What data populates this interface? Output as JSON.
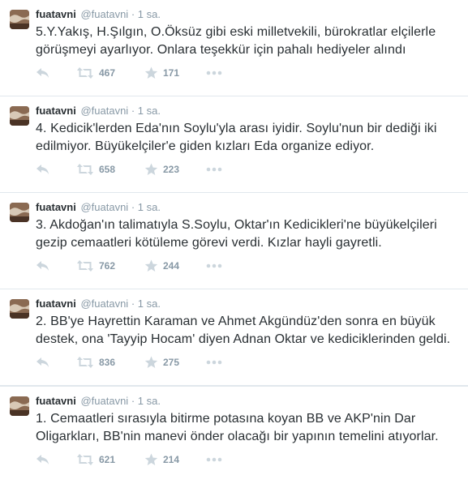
{
  "tweets": [
    {
      "name": "fuatavni",
      "handle": "@fuatavni",
      "separator": "·",
      "time": "1 sa.",
      "text": "5.Y.Yakış, H.Şılgın, O.Öksüz gibi eski milletvekili, bürokratlar elçilerle görüşmeyi ayarlıyor. Onlara teşekkür için pahalı hediyeler alındı",
      "retweets": "467",
      "favorites": "171"
    },
    {
      "name": "fuatavni",
      "handle": "@fuatavni",
      "separator": "·",
      "time": "1 sa.",
      "text": "4. Kedicik'lerden Eda'nın Soylu'yla arası iyidir. Soylu'nun bir dediği iki edilmiyor. Büyükelçiler'e giden kızları Eda organize ediyor.",
      "retweets": "658",
      "favorites": "223"
    },
    {
      "name": "fuatavni",
      "handle": "@fuatavni",
      "separator": "·",
      "time": "1 sa.",
      "text": "3. Akdoğan'ın talimatıyla S.Soylu, Oktar'ın Kedicikleri'ne büyükelçileri gezip cemaatleri kötüleme görevi verdi. Kızlar hayli gayretli.",
      "retweets": "762",
      "favorites": "244"
    },
    {
      "name": "fuatavni",
      "handle": "@fuatavni",
      "separator": "·",
      "time": "1 sa.",
      "text": "2. BB'ye Hayrettin Karaman ve Ahmet Akgündüz'den sonra en büyük destek, ona 'Tayyip Hocam' diyen Adnan Oktar ve kediciklerinden geldi.",
      "retweets": "836",
      "favorites": "275"
    },
    {
      "name": "fuatavni",
      "handle": "@fuatavni",
      "separator": "·",
      "time": "1 sa.",
      "text": "1. Cemaatleri sırasıyla bitirme potasına koyan BB ve AKP'nin Dar Oligarkları, BB'nin manevi önder olacağı bir yapının temelini atıyorlar.",
      "retweets": "621",
      "favorites": "214"
    }
  ],
  "colors": {
    "text": "#292f33",
    "muted": "#8899a6",
    "icon": "#ccd6dd",
    "border": "#e1e8ed"
  },
  "icons": {
    "reply": "reply-icon",
    "retweet": "retweet-icon",
    "favorite": "star-icon",
    "more": "more-dots-icon"
  }
}
